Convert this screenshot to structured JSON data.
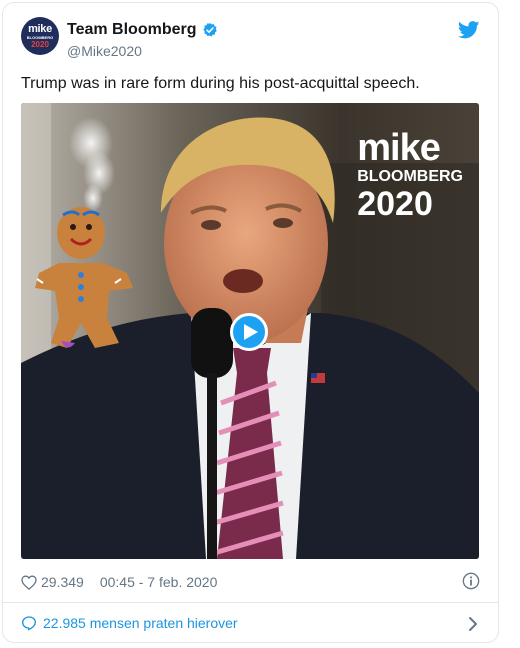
{
  "account": {
    "name": "Team Bloomberg",
    "handle": "@Mike2020",
    "avatar": {
      "line1": "mike",
      "line2": "BLOOMBERG",
      "line3": "2020"
    }
  },
  "tweet": {
    "text": "Trump was in rare form during his post-acquittal speech."
  },
  "media": {
    "brand_line1": "mike",
    "brand_line2": "BLOOMBERG",
    "brand_line3": "2020"
  },
  "footer": {
    "likes": "29.349",
    "timestamp": "00:45 - 7 feb. 2020",
    "conversation": "22.985 mensen praten hierover"
  },
  "colors": {
    "twitter_blue": "#1da1f2",
    "link_blue": "#1b95e0",
    "muted": "#657786",
    "border": "#e1e8ed",
    "avatar_navy": "#1f2d5c",
    "avatar_red": "#e8413c"
  },
  "icons": [
    "verified-icon",
    "twitter-bird-icon",
    "play-icon",
    "heart-icon",
    "info-icon",
    "speech-bubble-icon",
    "chevron-right-icon"
  ]
}
